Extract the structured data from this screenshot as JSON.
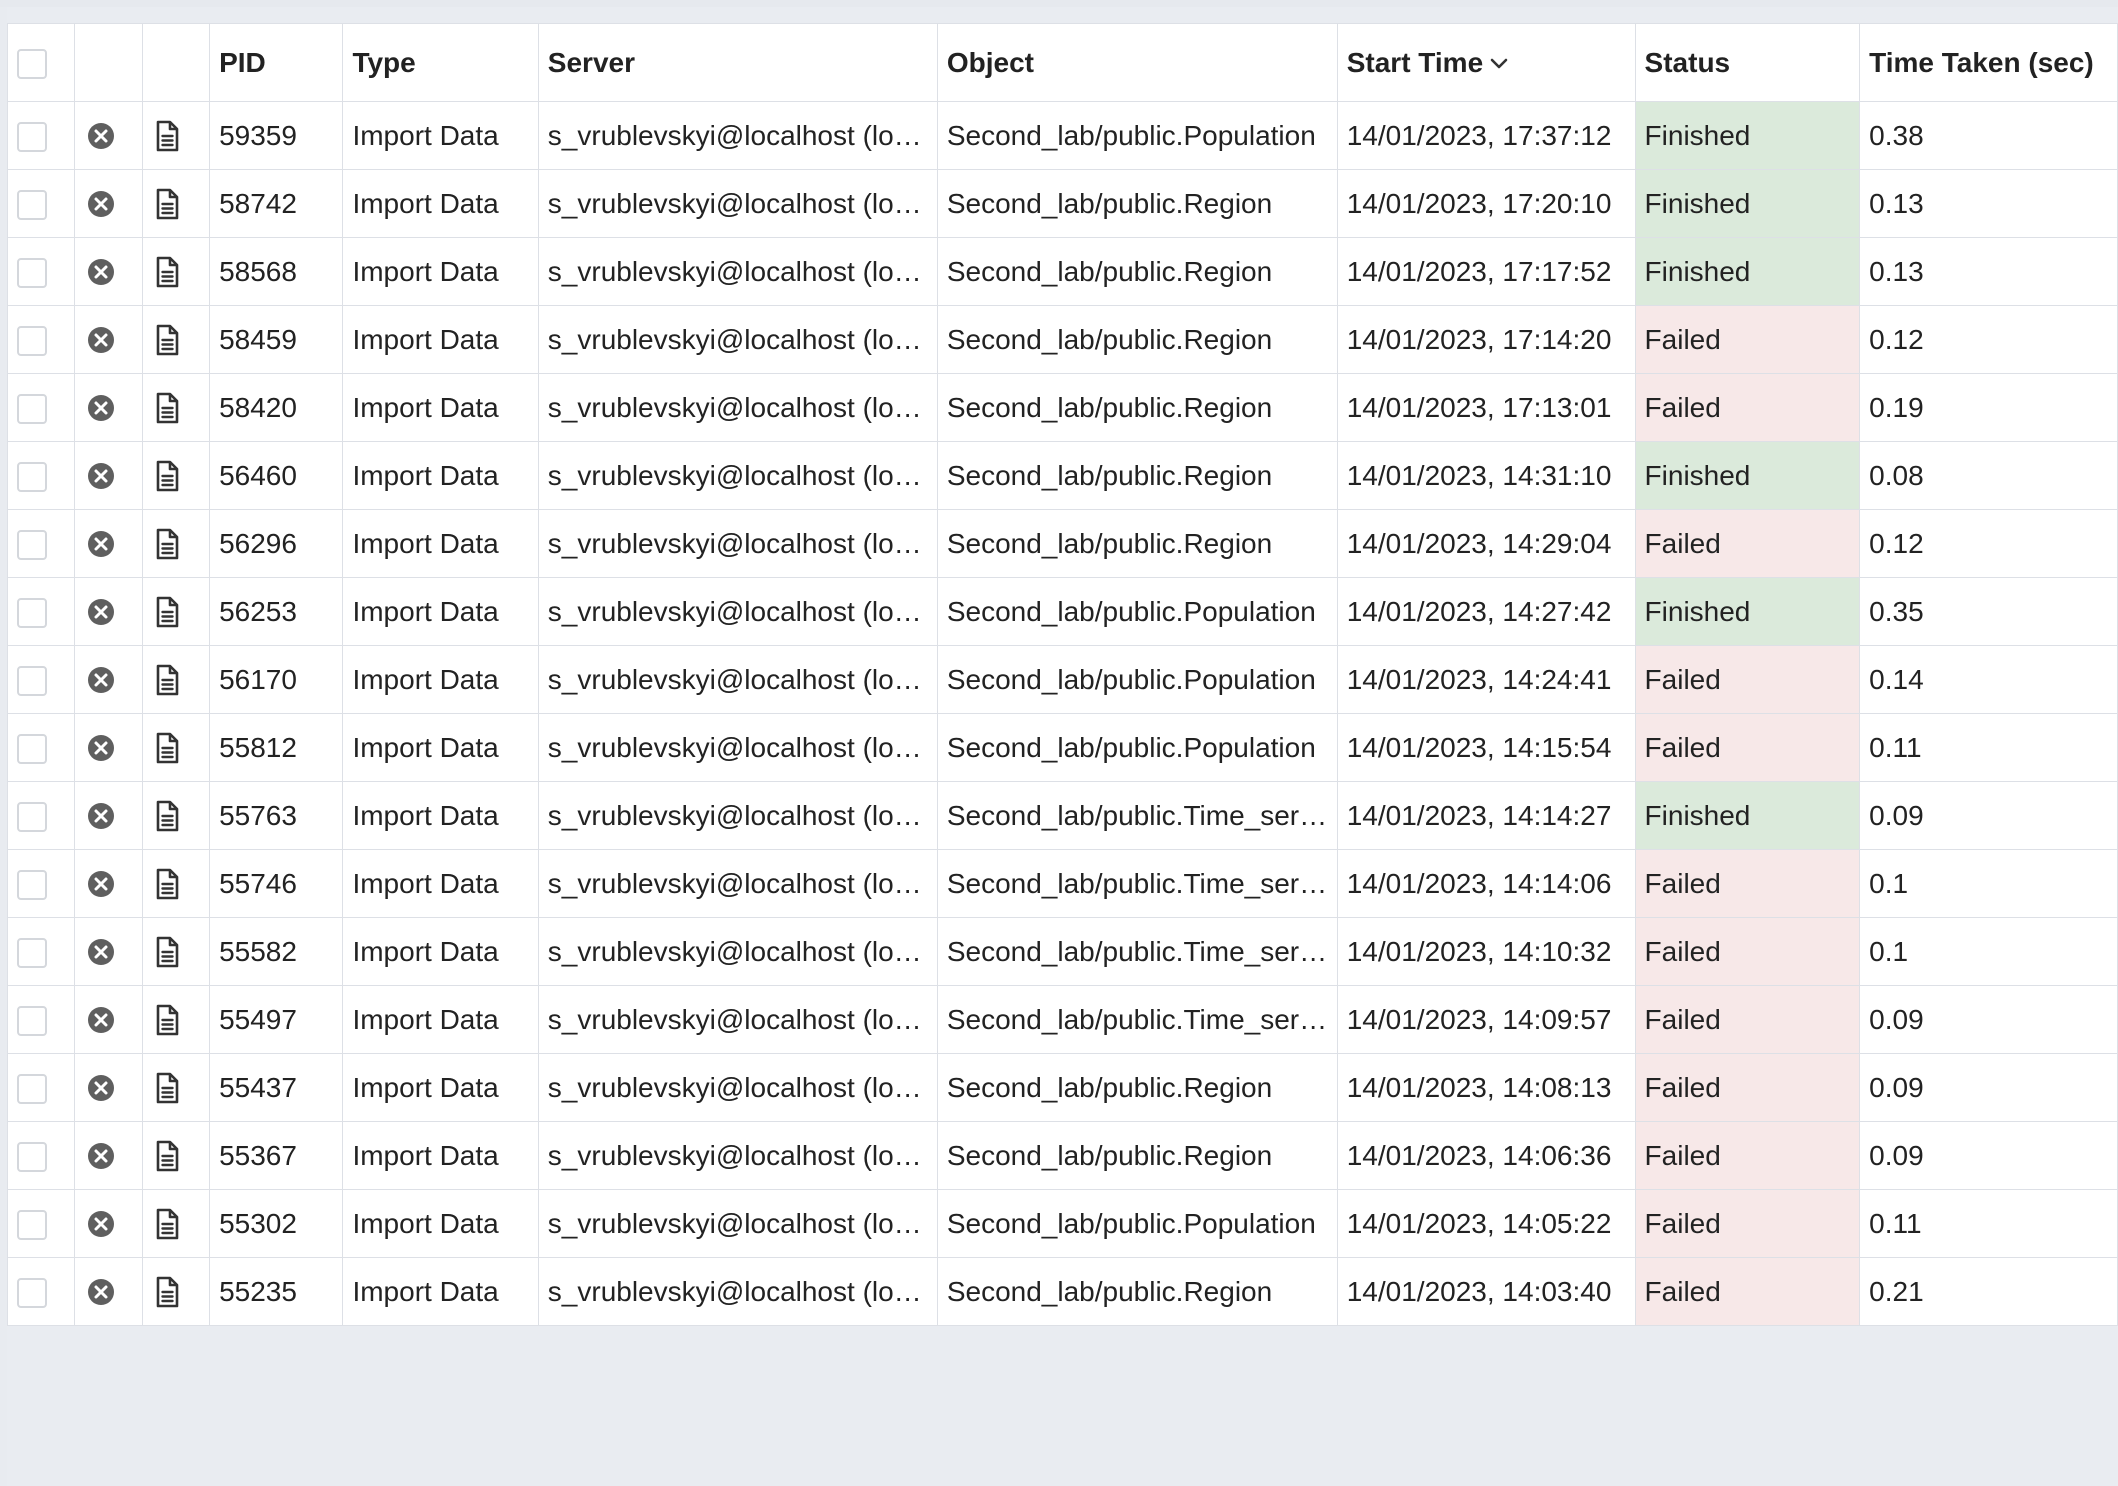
{
  "columns": {
    "pid": "PID",
    "type": "Type",
    "server": "Server",
    "object": "Object",
    "start_time": "Start Time",
    "status": "Status",
    "time_taken": "Time Taken (sec)"
  },
  "icons": {
    "select_all": "checkbox",
    "sort": "chevron-down-icon",
    "stop": "cancel-circle-icon",
    "logs": "document-icon"
  },
  "colors": {
    "finished_bg": "#dbeadb",
    "failed_bg": "#f7e8e8",
    "border": "#dde0e6",
    "page_bg": "#e9ecf1"
  },
  "rows": [
    {
      "pid": "59359",
      "type": "Import Data",
      "server": "s_vrublevskyi@localhost (lo…",
      "object": "Second_lab/public.Population",
      "start_time": "14/01/2023, 17:37:12",
      "status": "Finished",
      "time_taken": "0.38"
    },
    {
      "pid": "58742",
      "type": "Import Data",
      "server": "s_vrublevskyi@localhost (lo…",
      "object": "Second_lab/public.Region",
      "start_time": "14/01/2023, 17:20:10",
      "status": "Finished",
      "time_taken": "0.13"
    },
    {
      "pid": "58568",
      "type": "Import Data",
      "server": "s_vrublevskyi@localhost (lo…",
      "object": "Second_lab/public.Region",
      "start_time": "14/01/2023, 17:17:52",
      "status": "Finished",
      "time_taken": "0.13"
    },
    {
      "pid": "58459",
      "type": "Import Data",
      "server": "s_vrublevskyi@localhost (lo…",
      "object": "Second_lab/public.Region",
      "start_time": "14/01/2023, 17:14:20",
      "status": "Failed",
      "time_taken": "0.12"
    },
    {
      "pid": "58420",
      "type": "Import Data",
      "server": "s_vrublevskyi@localhost (lo…",
      "object": "Second_lab/public.Region",
      "start_time": "14/01/2023, 17:13:01",
      "status": "Failed",
      "time_taken": "0.19"
    },
    {
      "pid": "56460",
      "type": "Import Data",
      "server": "s_vrublevskyi@localhost (lo…",
      "object": "Second_lab/public.Region",
      "start_time": "14/01/2023, 14:31:10",
      "status": "Finished",
      "time_taken": "0.08"
    },
    {
      "pid": "56296",
      "type": "Import Data",
      "server": "s_vrublevskyi@localhost (lo…",
      "object": "Second_lab/public.Region",
      "start_time": "14/01/2023, 14:29:04",
      "status": "Failed",
      "time_taken": "0.12"
    },
    {
      "pid": "56253",
      "type": "Import Data",
      "server": "s_vrublevskyi@localhost (lo…",
      "object": "Second_lab/public.Population",
      "start_time": "14/01/2023, 14:27:42",
      "status": "Finished",
      "time_taken": "0.35"
    },
    {
      "pid": "56170",
      "type": "Import Data",
      "server": "s_vrublevskyi@localhost (lo…",
      "object": "Second_lab/public.Population",
      "start_time": "14/01/2023, 14:24:41",
      "status": "Failed",
      "time_taken": "0.14"
    },
    {
      "pid": "55812",
      "type": "Import Data",
      "server": "s_vrublevskyi@localhost (lo…",
      "object": "Second_lab/public.Population",
      "start_time": "14/01/2023, 14:15:54",
      "status": "Failed",
      "time_taken": "0.11"
    },
    {
      "pid": "55763",
      "type": "Import Data",
      "server": "s_vrublevskyi@localhost (lo…",
      "object": "Second_lab/public.Time_ser…",
      "start_time": "14/01/2023, 14:14:27",
      "status": "Finished",
      "time_taken": "0.09"
    },
    {
      "pid": "55746",
      "type": "Import Data",
      "server": "s_vrublevskyi@localhost (lo…",
      "object": "Second_lab/public.Time_ser…",
      "start_time": "14/01/2023, 14:14:06",
      "status": "Failed",
      "time_taken": "0.1"
    },
    {
      "pid": "55582",
      "type": "Import Data",
      "server": "s_vrublevskyi@localhost (lo…",
      "object": "Second_lab/public.Time_ser…",
      "start_time": "14/01/2023, 14:10:32",
      "status": "Failed",
      "time_taken": "0.1"
    },
    {
      "pid": "55497",
      "type": "Import Data",
      "server": "s_vrublevskyi@localhost (lo…",
      "object": "Second_lab/public.Time_ser…",
      "start_time": "14/01/2023, 14:09:57",
      "status": "Failed",
      "time_taken": "0.09"
    },
    {
      "pid": "55437",
      "type": "Import Data",
      "server": "s_vrublevskyi@localhost (lo…",
      "object": "Second_lab/public.Region",
      "start_time": "14/01/2023, 14:08:13",
      "status": "Failed",
      "time_taken": "0.09"
    },
    {
      "pid": "55367",
      "type": "Import Data",
      "server": "s_vrublevskyi@localhost (lo…",
      "object": "Second_lab/public.Region",
      "start_time": "14/01/2023, 14:06:36",
      "status": "Failed",
      "time_taken": "0.09"
    },
    {
      "pid": "55302",
      "type": "Import Data",
      "server": "s_vrublevskyi@localhost (lo…",
      "object": "Second_lab/public.Population",
      "start_time": "14/01/2023, 14:05:22",
      "status": "Failed",
      "time_taken": "0.11"
    },
    {
      "pid": "55235",
      "type": "Import Data",
      "server": "s_vrublevskyi@localhost (lo…",
      "object": "Second_lab/public.Region",
      "start_time": "14/01/2023, 14:03:40",
      "status": "Failed",
      "time_taken": "0.21"
    }
  ]
}
